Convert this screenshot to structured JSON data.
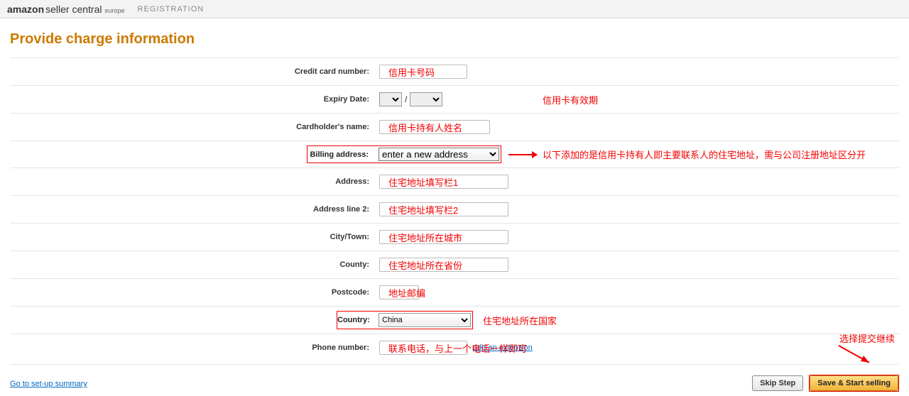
{
  "header": {
    "brand_amazon": "amazon",
    "brand_seller": "seller central",
    "brand_region": "europe",
    "registration": "REGISTRATION"
  },
  "title": "Provide charge information",
  "labels": {
    "card_number": "Credit card number:",
    "expiry": "Expiry Date:",
    "cardholder": "Cardholder's name:",
    "billing_addr": "Billing address:",
    "address": "Address:",
    "address2": "Address line 2:",
    "city": "City/Town:",
    "county": "County:",
    "postcode": "Postcode:",
    "country": "Country:",
    "phone": "Phone number:"
  },
  "values": {
    "billing_select": "enter a new address",
    "country_select": "China",
    "expiry_sep": "/",
    "add_ext": "add an extension"
  },
  "annotations": {
    "card_number": "信用卡号码",
    "expiry": "信用卡有效期",
    "cardholder": "信用卡持有人姓名",
    "billing_note": "以下添加的是信用卡持有人即主要联系人的住宅地址，需与公司注册地址区分开",
    "addr1": "住宅地址填写栏1",
    "addr2": "住宅地址填写栏2",
    "city": "住宅地址所在城市",
    "county": "住宅地址所在省份",
    "postcode": "地址邮编",
    "country": "住宅地址所在国家",
    "phone": "联系电话，与上一个电话一样即可",
    "submit": "选择提交继续"
  },
  "footer": {
    "setup_link": "Go to set-up summary",
    "skip": "Skip Step",
    "save": "Save & Start selling"
  }
}
